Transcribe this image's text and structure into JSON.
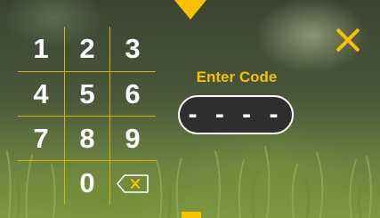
{
  "keypad": {
    "keys": [
      "1",
      "2",
      "3",
      "4",
      "5",
      "6",
      "7",
      "8",
      "9",
      "0"
    ]
  },
  "code_entry": {
    "label": "Enter Code",
    "value": "- - - -"
  },
  "colors": {
    "accent": "#f7c000",
    "field_background": "#2e2e2e",
    "text": "#ffffff"
  },
  "icons": {
    "close": "close-icon",
    "backspace": "backspace-icon",
    "top_marker": "triangle-down-icon"
  }
}
